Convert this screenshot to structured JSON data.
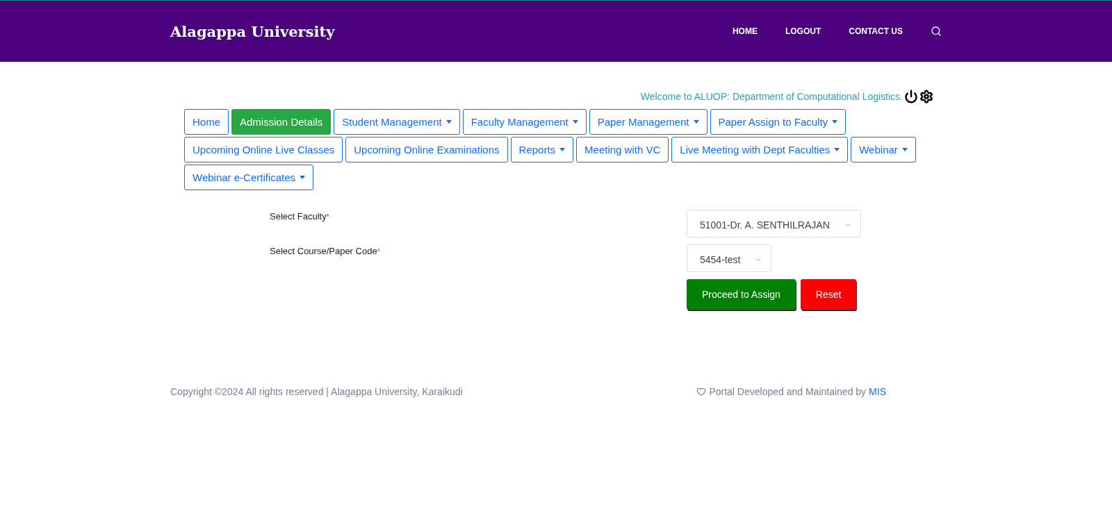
{
  "header": {
    "brand": "Alagappa University",
    "nav": [
      {
        "label": "HOME"
      },
      {
        "label": "LOGOUT"
      },
      {
        "label": "CONTACT US"
      }
    ]
  },
  "welcome": "Welcome to ALUOP: Department of Computational Logistics.",
  "menu": [
    {
      "label": "Home",
      "kind": "link",
      "selected": false
    },
    {
      "label": "Admission Details",
      "kind": "link",
      "selected": true
    },
    {
      "label": "Student Management",
      "kind": "dropdown",
      "selected": false
    },
    {
      "label": "Faculty Management",
      "kind": "dropdown",
      "selected": false
    },
    {
      "label": "Paper Management",
      "kind": "dropdown",
      "selected": false
    },
    {
      "label": "Paper Assign to Faculty",
      "kind": "dropdown",
      "selected": false
    },
    {
      "label": "Upcoming Online Live Classes",
      "kind": "link",
      "selected": false
    },
    {
      "label": "Upcoming Online Examinations",
      "kind": "link",
      "selected": false
    },
    {
      "label": "Reports",
      "kind": "dropdown",
      "selected": false
    },
    {
      "label": "Meeting with VC",
      "kind": "link",
      "selected": false
    },
    {
      "label": "Live Meeting with Dept Faculties",
      "kind": "dropdown",
      "selected": false
    },
    {
      "label": "Webinar",
      "kind": "dropdown",
      "selected": false
    },
    {
      "label": "Webinar e-Certificates",
      "kind": "dropdown",
      "selected": false
    }
  ],
  "form": {
    "fields": [
      {
        "label": "Select Faculty",
        "required_mark": "*",
        "value": "51001-Dr. A. SENTHILRAJAN"
      },
      {
        "label": "Select Course/Paper Code",
        "required_mark": "*",
        "value": "5454-test"
      }
    ],
    "buttons": [
      {
        "label": "Proceed to Assign",
        "kind": "primary"
      },
      {
        "label": "Reset",
        "kind": "danger"
      }
    ]
  },
  "footer": {
    "copyright": "Copyright ©2024 All rights reserved | Alagappa University, Karaikudi",
    "credit": "Portal Developed and Maintained by",
    "credit_link": "MIS"
  }
}
